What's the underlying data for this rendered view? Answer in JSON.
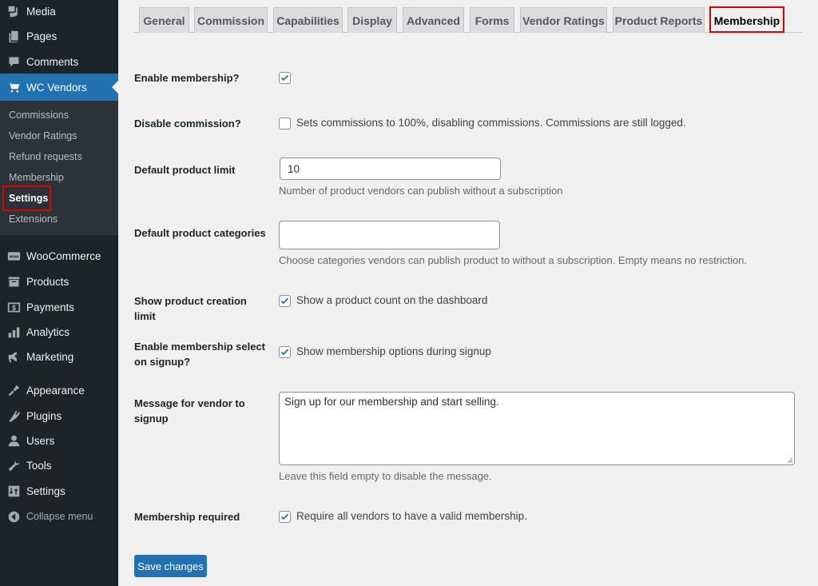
{
  "sidebar": {
    "top_items": [
      {
        "label": "Media",
        "icon": "media-icon"
      },
      {
        "label": "Pages",
        "icon": "pages-icon"
      },
      {
        "label": "Comments",
        "icon": "comments-icon"
      },
      {
        "label": "WC Vendors",
        "icon": "cart-icon",
        "active": true
      }
    ],
    "submenu": [
      {
        "label": "Commissions"
      },
      {
        "label": "Vendor Ratings"
      },
      {
        "label": "Refund requests"
      },
      {
        "label": "Membership"
      },
      {
        "label": "Settings",
        "current": true
      },
      {
        "label": "Extensions"
      }
    ],
    "bottom_items": [
      {
        "label": "WooCommerce",
        "icon": "woo-icon"
      },
      {
        "label": "Products",
        "icon": "products-icon"
      },
      {
        "label": "Payments",
        "icon": "payments-icon"
      },
      {
        "label": "Analytics",
        "icon": "analytics-icon"
      },
      {
        "label": "Marketing",
        "icon": "marketing-icon"
      },
      {
        "label": "Appearance",
        "icon": "appearance-icon"
      },
      {
        "label": "Plugins",
        "icon": "plugins-icon"
      },
      {
        "label": "Users",
        "icon": "users-icon"
      },
      {
        "label": "Tools",
        "icon": "tools-icon"
      },
      {
        "label": "Settings",
        "icon": "settings-icon"
      }
    ],
    "collapse_label": "Collapse menu"
  },
  "tabs": [
    {
      "label": "General"
    },
    {
      "label": "Commission"
    },
    {
      "label": "Capabilities"
    },
    {
      "label": "Display"
    },
    {
      "label": "Advanced"
    },
    {
      "label": "Forms"
    },
    {
      "label": "Vendor Ratings"
    },
    {
      "label": "Product Reports"
    },
    {
      "label": "Membership",
      "active": true
    }
  ],
  "form": {
    "enable_membership": {
      "label": "Enable membership?",
      "checked": true
    },
    "disable_commission": {
      "label": "Disable commission?",
      "checked": false,
      "text": "Sets commissions to 100%, disabling commissions. Commissions are still logged."
    },
    "default_product_limit": {
      "label": "Default product limit",
      "value": "10",
      "description": "Number of product vendors can publish without a subscription"
    },
    "default_product_categories": {
      "label": "Default product categories",
      "value": "",
      "description": "Choose categories vendors can publish product to without a subscription. Empty means no restriction."
    },
    "show_product_creation_limit": {
      "label": "Show product creation limit",
      "checked": true,
      "text": "Show a product count on the dashboard"
    },
    "enable_membership_select": {
      "label_line1": "Enable membership select",
      "label_line2": "on signup?",
      "checked": true,
      "text": "Show membership options during signup"
    },
    "message_for_vendor": {
      "label_line1": "Message for vendor to",
      "label_line2": "signup",
      "value": "Sign up for our membership and start selling.",
      "description": "Leave this field empty to disable the message."
    },
    "membership_required": {
      "label": "Membership required",
      "checked": true,
      "text": "Require all vendors to have a valid membership."
    }
  },
  "save_label": "Save changes",
  "colors": {
    "accent": "#2271b1",
    "sidebar_bg": "#1d2327",
    "highlight": "#e00000"
  }
}
